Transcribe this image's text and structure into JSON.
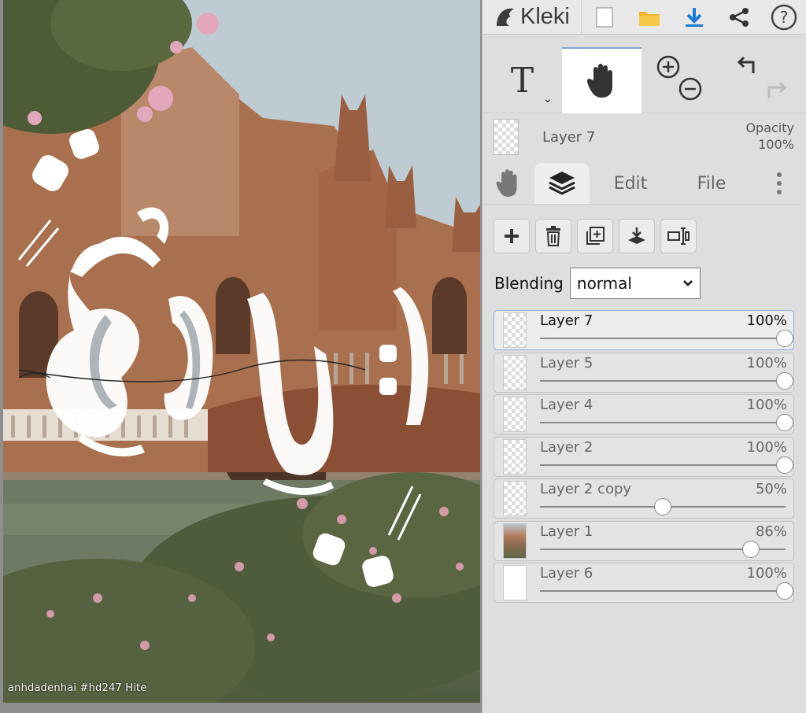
{
  "app": {
    "name": "Kleki"
  },
  "canvas": {
    "watermark": "anhdadenhai #hd247 Hite"
  },
  "topbar": {
    "buttons": [
      {
        "icon": "new-file-icon"
      },
      {
        "icon": "open-folder-icon"
      },
      {
        "icon": "download-icon"
      },
      {
        "icon": "share-icon"
      },
      {
        "icon": "help-icon"
      }
    ]
  },
  "tools": {
    "text_label": "T",
    "active": "hand",
    "items": [
      "text-tool",
      "hand-tool",
      "zoom-tool",
      "undo-redo"
    ]
  },
  "current_layer": {
    "name": "Layer 7",
    "opacity_label": "Opacity",
    "opacity_value": "100%"
  },
  "tabs": {
    "edit": "Edit",
    "file": "File",
    "active": "layers"
  },
  "layer_actions": [
    "add-layer",
    "delete-layer",
    "duplicate-layer",
    "merge-down",
    "rename-layer"
  ],
  "blending": {
    "label": "Blending",
    "value": "normal"
  },
  "layers": [
    {
      "name": "Layer 7",
      "opacity": "100%",
      "level": 1.0,
      "thumb": "checker",
      "selected": true
    },
    {
      "name": "Layer 5",
      "opacity": "100%",
      "level": 1.0,
      "thumb": "checker",
      "selected": false
    },
    {
      "name": "Layer 4",
      "opacity": "100%",
      "level": 1.0,
      "thumb": "checker",
      "selected": false
    },
    {
      "name": "Layer 2",
      "opacity": "100%",
      "level": 1.0,
      "thumb": "checker",
      "selected": false
    },
    {
      "name": "Layer 2 copy",
      "opacity": "50%",
      "level": 0.5,
      "thumb": "checker",
      "selected": false
    },
    {
      "name": "Layer 1",
      "opacity": "86%",
      "level": 0.86,
      "thumb": "photo",
      "selected": false
    },
    {
      "name": "Layer 6",
      "opacity": "100%",
      "level": 1.0,
      "thumb": "white",
      "selected": false
    }
  ],
  "colors": {
    "accent": "#1e7ad6",
    "folder": "#f2b52c",
    "selected_border": "#8fb0de"
  }
}
